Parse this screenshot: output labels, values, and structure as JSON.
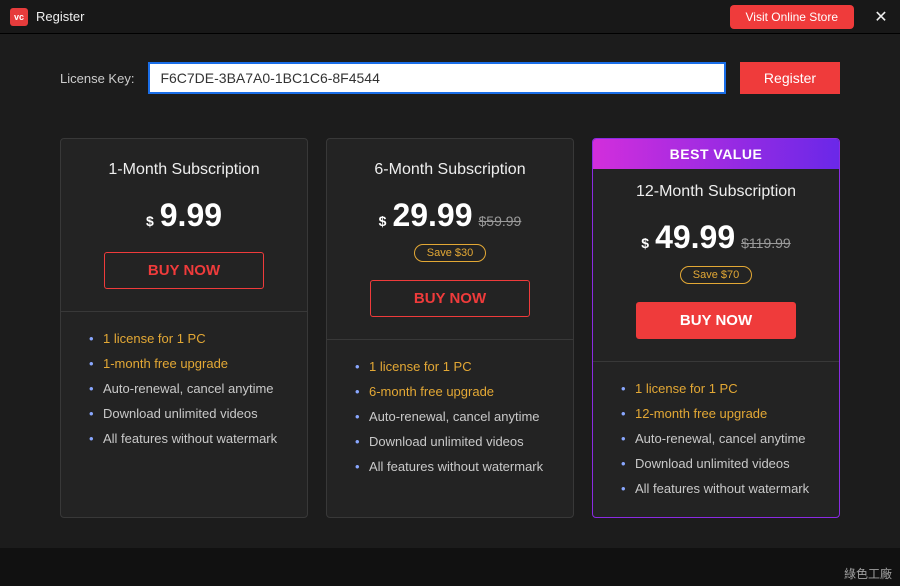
{
  "titlebar": {
    "logo_text": "vc",
    "title": "Register",
    "store_button": "Visit Online Store",
    "close_label": "✕"
  },
  "license": {
    "label": "License Key:",
    "value": "F6C7DE-3BA7A0-1BC1C6-8F4544",
    "register_button": "Register"
  },
  "plans": [
    {
      "title": "1-Month Subscription",
      "currency": "$",
      "price": "9.99",
      "old_price": "",
      "save": "",
      "buy": "BUY NOW",
      "solid": false,
      "best": false,
      "features": [
        {
          "text": "1 license for 1 PC",
          "hl": true
        },
        {
          "text": "1-month free upgrade",
          "hl": true
        },
        {
          "text": "Auto-renewal, cancel anytime",
          "hl": false
        },
        {
          "text": "Download unlimited videos",
          "hl": false
        },
        {
          "text": "All features without watermark",
          "hl": false
        }
      ]
    },
    {
      "title": "6-Month Subscription",
      "currency": "$",
      "price": "29.99",
      "old_price": "$59.99",
      "save": "Save $30",
      "buy": "BUY NOW",
      "solid": false,
      "best": false,
      "features": [
        {
          "text": "1 license for 1 PC",
          "hl": true
        },
        {
          "text": "6-month free upgrade",
          "hl": true
        },
        {
          "text": "Auto-renewal, cancel anytime",
          "hl": false
        },
        {
          "text": "Download unlimited videos",
          "hl": false
        },
        {
          "text": "All features without watermark",
          "hl": false
        }
      ]
    },
    {
      "title": "12-Month Subscription",
      "currency": "$",
      "price": "49.99",
      "old_price": "$119.99",
      "save": "Save $70",
      "buy": "BUY NOW",
      "solid": true,
      "best": true,
      "best_label": "BEST VALUE",
      "features": [
        {
          "text": "1 license for 1 PC",
          "hl": true
        },
        {
          "text": "12-month free upgrade",
          "hl": true
        },
        {
          "text": "Auto-renewal, cancel anytime",
          "hl": false
        },
        {
          "text": "Download unlimited videos",
          "hl": false
        },
        {
          "text": "All features without watermark",
          "hl": false
        }
      ]
    }
  ],
  "watermark": "綠色工廠"
}
